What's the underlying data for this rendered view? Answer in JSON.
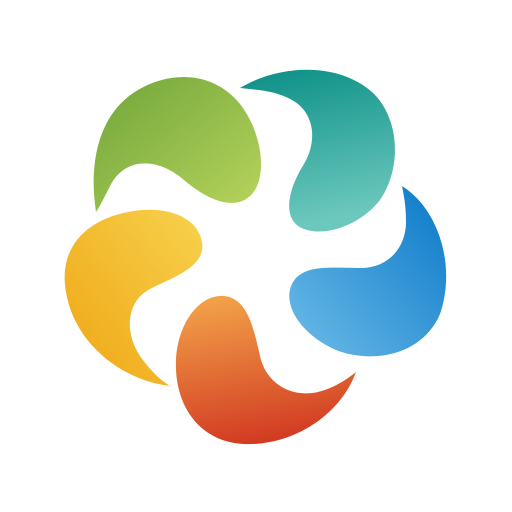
{
  "logo": {
    "name": "five-petal-swirl-logo",
    "petals": [
      {
        "name": "green-petal",
        "colors": [
          "#6FA53A",
          "#B8D45C"
        ]
      },
      {
        "name": "teal-petal",
        "colors": [
          "#0A8F86",
          "#6CC8BD"
        ]
      },
      {
        "name": "blue-petal",
        "colors": [
          "#0A78C8",
          "#6DBCE8"
        ]
      },
      {
        "name": "orange-petal",
        "colors": [
          "#D23B22",
          "#F3A34A"
        ]
      },
      {
        "name": "yellow-petal",
        "colors": [
          "#EFA514",
          "#F7D24D"
        ]
      }
    ]
  }
}
